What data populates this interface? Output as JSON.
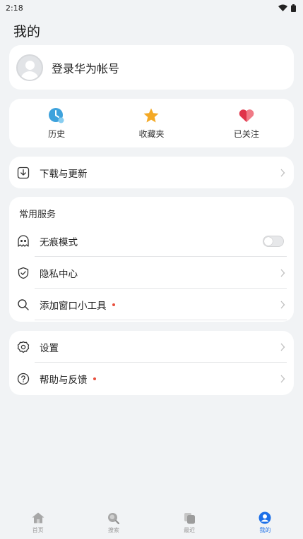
{
  "status_bar": {
    "time": "2:18"
  },
  "page": {
    "title": "我的"
  },
  "account": {
    "login_label": "登录华为帐号"
  },
  "quick_actions": [
    {
      "label": "历史",
      "icon": "clock-icon"
    },
    {
      "label": "收藏夹",
      "icon": "star-icon"
    },
    {
      "label": "已关注",
      "icon": "heart-icon"
    }
  ],
  "download": {
    "label": "下载与更新",
    "icon": "download-icon"
  },
  "services": {
    "title": "常用服务",
    "items": [
      {
        "label": "无痕模式",
        "icon": "ghost-icon",
        "toggle": false
      },
      {
        "label": "隐私中心",
        "icon": "shield-check-icon"
      },
      {
        "label": "添加窗口小工具",
        "icon": "search-icon",
        "badge": true
      }
    ]
  },
  "settings": {
    "items": [
      {
        "label": "设置",
        "icon": "gear-icon"
      },
      {
        "label": "帮助与反馈",
        "icon": "question-icon",
        "badge": true
      }
    ]
  },
  "bottom_nav": [
    {
      "label": "首页",
      "icon": "home-icon"
    },
    {
      "label": "搜索",
      "icon": "search-icon"
    },
    {
      "label": "最近",
      "icon": "recent-icon"
    },
    {
      "label": "我的",
      "icon": "profile-icon",
      "active": true
    }
  ],
  "colors": {
    "accent": "#1c6fe8",
    "badge": "#e84f3d",
    "background": "#f1f3f5"
  }
}
